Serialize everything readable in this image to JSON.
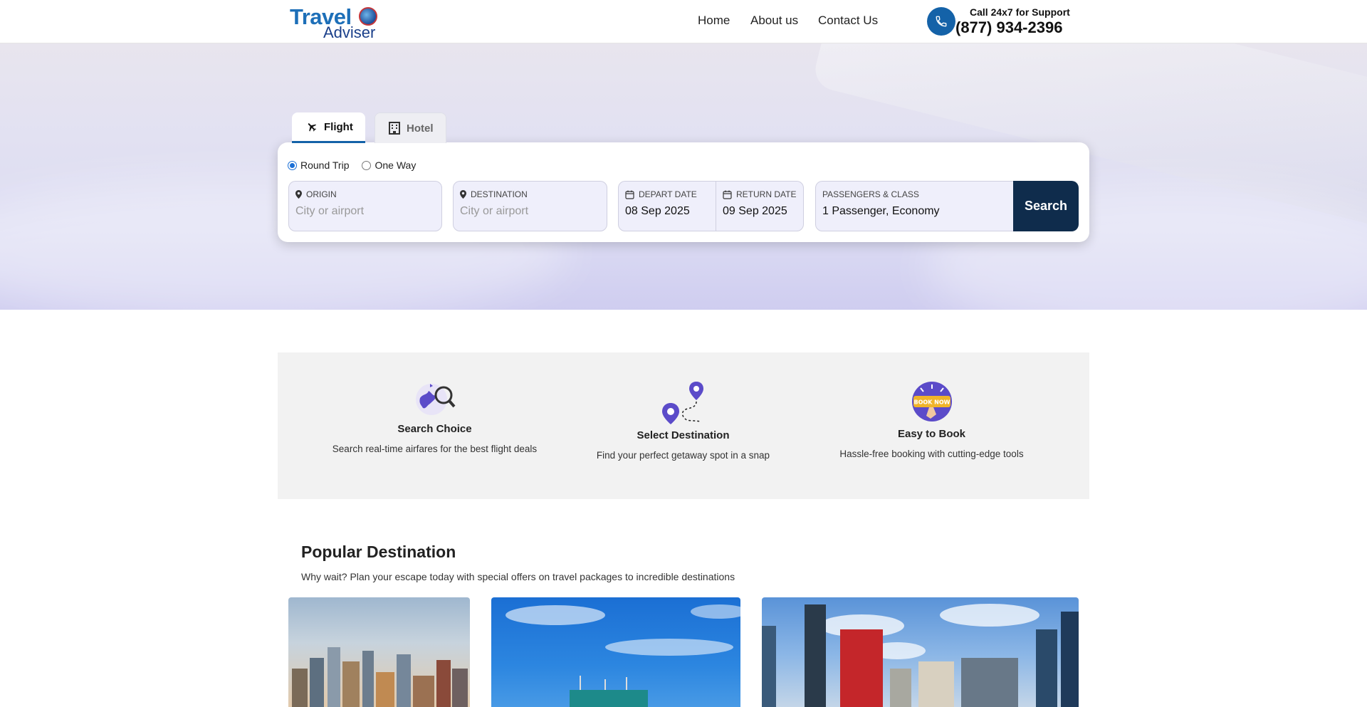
{
  "header": {
    "logo_line1": "Travel",
    "logo_line2": "Adviser",
    "nav": [
      "Home",
      "About us",
      "Contact Us"
    ],
    "support_label": "Call 24x7 for Support",
    "support_number": "(877) 934-2396"
  },
  "search": {
    "tabs": [
      {
        "label": "Flight",
        "icon": "airplane-icon",
        "active": true
      },
      {
        "label": "Hotel",
        "icon": "building-icon",
        "active": false
      }
    ],
    "trip_types": [
      {
        "label": "Round Trip",
        "selected": true
      },
      {
        "label": "One Way",
        "selected": false
      }
    ],
    "origin": {
      "label": "ORIGIN",
      "placeholder": "City or airport"
    },
    "destination": {
      "label": "DESTINATION",
      "placeholder": "City or airport"
    },
    "depart": {
      "label": "DEPART DATE",
      "value": "08 Sep 2025"
    },
    "return": {
      "label": "RETURN DATE",
      "value": "09 Sep 2025"
    },
    "passengers": {
      "label": "PASSENGERS & CLASS",
      "value": "1 Passenger, Economy"
    },
    "button": "Search"
  },
  "features": [
    {
      "title": "Search Choice",
      "desc": "Search real-time airfares for the best flight deals",
      "icon": "globe-search-icon"
    },
    {
      "title": "Select Destination",
      "desc": "Find your perfect getaway spot in a snap",
      "icon": "map-pins-icon"
    },
    {
      "title": "Easy to Book",
      "desc": "Hassle-free booking with cutting-edge tools",
      "icon": "book-now-icon",
      "icon_text": "BOOK NOW"
    }
  ],
  "popular": {
    "title": "Popular Destination",
    "subtitle": "Why wait? Plan your escape today with special offers on travel packages to incredible destinations"
  },
  "colors": {
    "brand_blue": "#1462a8",
    "search_button": "#0f2c4c",
    "field_bg": "#efeffb"
  }
}
